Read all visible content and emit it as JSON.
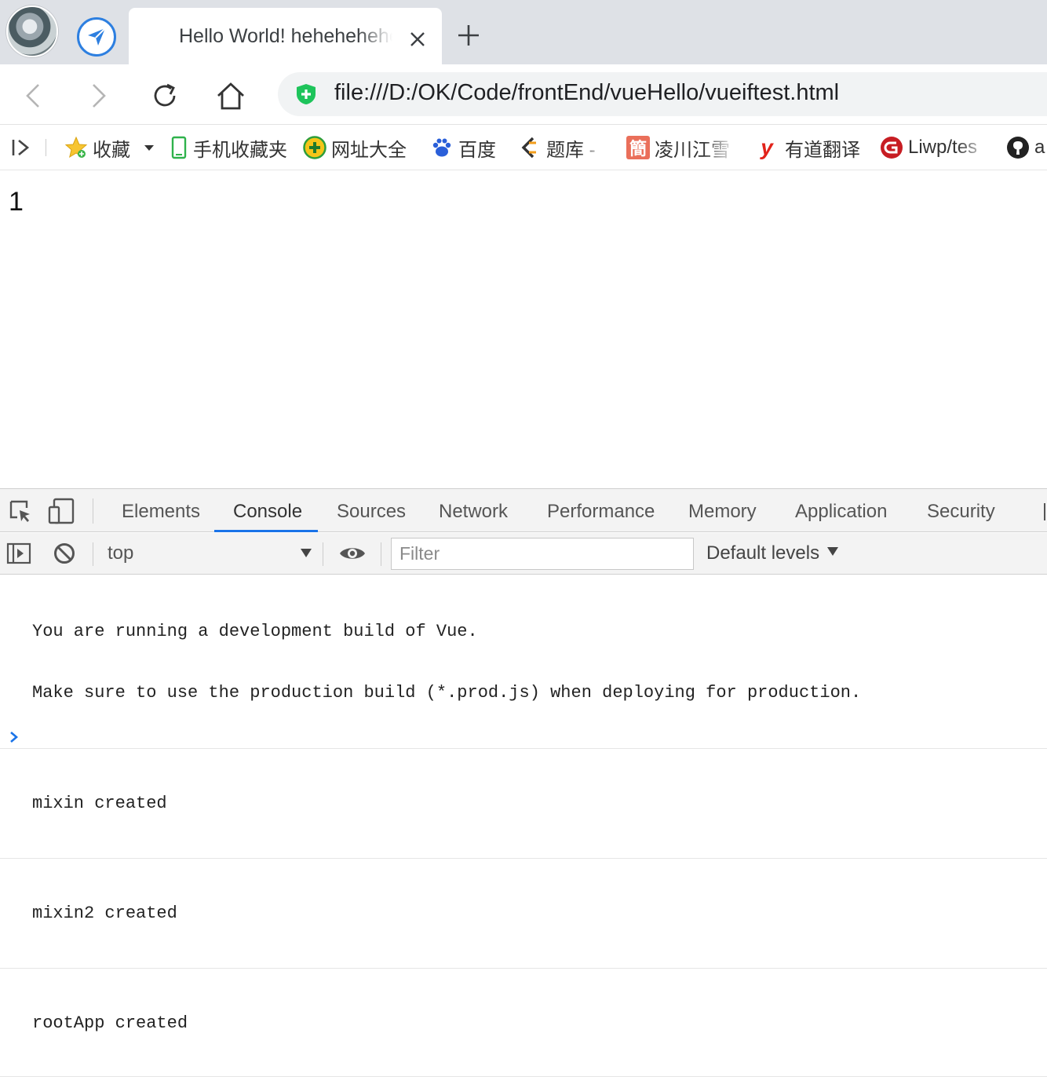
{
  "browser": {
    "tab": {
      "title": "Hello World! hehehehehe"
    },
    "address_bar": {
      "url": "file:///D:/OK/Code/frontEnd/vueHello/vueiftest.html"
    },
    "bookmarks": [
      {
        "label": "收藏",
        "icon": "star-icon"
      },
      {
        "label": "手机收藏夹",
        "icon": "phone-icon"
      },
      {
        "label": "网址大全",
        "icon": "plus-circle-icon"
      },
      {
        "label": "百度",
        "icon": "baidu-paw-icon"
      },
      {
        "label": "题库 -",
        "icon": "quiz-icon"
      },
      {
        "label": "凌川江雪",
        "icon": "jian-icon"
      },
      {
        "label": "有道翻译",
        "icon": "youdao-icon"
      },
      {
        "label": "Liwp/tes",
        "icon": "gitee-icon"
      },
      {
        "label": "a",
        "icon": "github-icon"
      }
    ],
    "colors": {
      "accent": "#1a73e8",
      "secure": "#1ec45b",
      "tabstrip": "#dee1e6"
    }
  },
  "page": {
    "content": "1"
  },
  "devtools": {
    "tabs": [
      "Elements",
      "Console",
      "Sources",
      "Network",
      "Performance",
      "Memory",
      "Application",
      "Security"
    ],
    "active_tab": "Console",
    "context": "top",
    "filter_placeholder": "Filter",
    "levels": "Default levels",
    "console_messages": [
      [
        "You are running a development build of Vue.",
        "Make sure to use the production build (*.prod.js) when deploying for production."
      ],
      [
        "mixin created"
      ],
      [
        "mixin2 created"
      ],
      [
        "rootApp created"
      ]
    ]
  }
}
